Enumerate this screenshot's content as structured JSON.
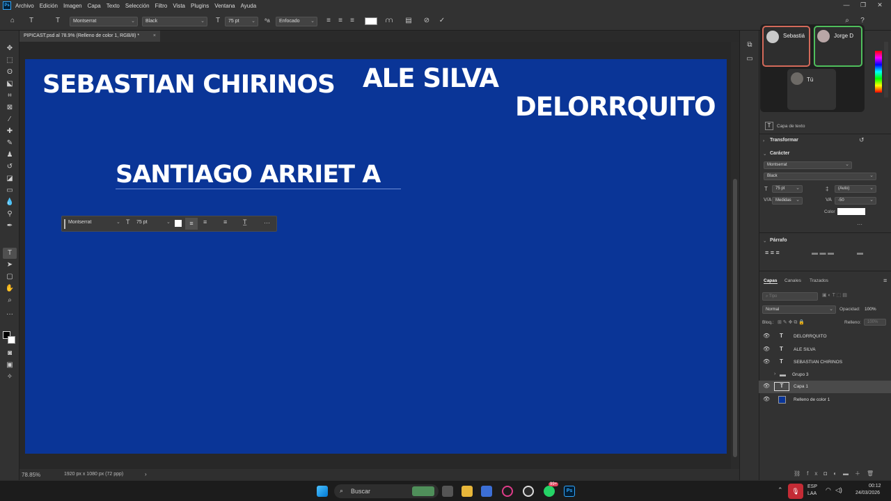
{
  "menubar": {
    "logo": "Ps",
    "items": [
      "Archivo",
      "Edición",
      "Imagen",
      "Capa",
      "Texto",
      "Selección",
      "Filtro",
      "Vista",
      "Plugins",
      "Ventana",
      "Ayuda"
    ]
  },
  "options": {
    "font_family": "Montserrat",
    "font_style": "Black",
    "font_size": "75 pt",
    "antialias": "Enfocado"
  },
  "document": {
    "tab_title": "PIPICAST.psd al 78.9% (Relleno de color 1, RGB/8) *",
    "texts": {
      "sebastian": "SEBASTIAN CHIRINOS",
      "ale": "ALE SILVA",
      "delorr": "DELORRQUITO",
      "santiago": "SANTIAGO ARRIET A"
    },
    "canvas_color": "#0a3597"
  },
  "context_bar": {
    "font": "Montserrat",
    "size": "75 pt",
    "more": "···"
  },
  "status": {
    "zoom": "78.85%",
    "dimensions": "1920 px x 1080 px (72 ppp)"
  },
  "call": {
    "p1": "Sebastiá",
    "p2": "Jorge D",
    "p3": "Tú"
  },
  "properties": {
    "layer_kind": "Capa de texto",
    "transform_title": "Transformar",
    "character_title": "Carácter",
    "font_family": "Montserrat",
    "font_style": "Black",
    "size": "75 pt",
    "leading": "(Auto)",
    "kerning": "Medidas",
    "tracking": "-50",
    "color_label": "Color",
    "more": "···",
    "paragraph_title": "Párrafo"
  },
  "layers_panel": {
    "tabs": [
      "Capas",
      "Canales",
      "Trazados"
    ],
    "search_placeholder": "Tipo",
    "blend_mode": "Normal",
    "opacity_label": "Opacidad:",
    "opacity_value": "100%",
    "lock_label": "Bloq.:",
    "fill_label": "Relleno:",
    "fill_value": "100%",
    "layers": [
      {
        "name": "DELORRQUITO",
        "type": "T"
      },
      {
        "name": "ALE SILVA",
        "type": "T"
      },
      {
        "name": "SEBASTIAN CHIRINOS",
        "type": "T"
      },
      {
        "name": "Grupo 3",
        "type": "folder"
      },
      {
        "name": "Capa 1",
        "type": "T"
      },
      {
        "name": "Relleno de color 1",
        "type": "fill"
      }
    ]
  },
  "taskbar": {
    "search": "Buscar",
    "badge": "99+",
    "lang1": "ESP",
    "lang2": "LAA",
    "time": "00:12",
    "date": "24/03/2026"
  }
}
